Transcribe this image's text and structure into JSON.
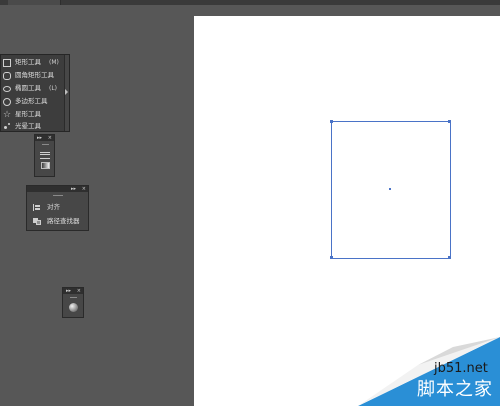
{
  "tool_flyout": {
    "items": [
      {
        "label": "矩形工具",
        "shortcut": "(M)",
        "icon": "rectangle-icon"
      },
      {
        "label": "圆角矩形工具",
        "shortcut": "",
        "icon": "rounded-rectangle-icon"
      },
      {
        "label": "椭圆工具",
        "shortcut": "(L)",
        "icon": "ellipse-icon"
      },
      {
        "label": "多边形工具",
        "shortcut": "",
        "icon": "polygon-icon"
      },
      {
        "label": "星形工具",
        "shortcut": "",
        "icon": "star-icon"
      },
      {
        "label": "光晕工具",
        "shortcut": "",
        "icon": "flare-icon"
      }
    ]
  },
  "panels": {
    "collapse_glyph": "▸▸",
    "close_glyph": "×",
    "align_pathfinder": {
      "items": [
        {
          "label": "对齐",
          "icon": "align-icon"
        },
        {
          "label": "路径查找器",
          "icon": "pathfinder-icon"
        }
      ]
    }
  },
  "watermark": {
    "url": "jb51.net",
    "name": "脚本之家"
  },
  "colors": {
    "workspace": "#575757",
    "artboard": "#ffffff",
    "selection": "#4a73c7"
  }
}
